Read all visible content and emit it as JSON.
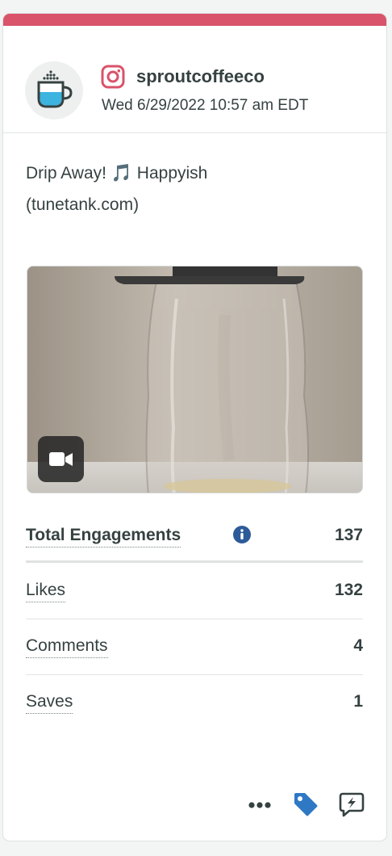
{
  "post": {
    "network_icon": "instagram-icon",
    "username": "sproutcoffeeco",
    "timestamp": "Wed 6/29/2022 10:57 am EDT",
    "caption_line1": "Drip Away! 🎵 Happyish",
    "caption_line2": "(tunetank.com)",
    "media_type": "video",
    "accent_color": "#d9536a"
  },
  "metrics": {
    "total_label": "Total Engagements",
    "total_value": "137",
    "rows": [
      {
        "label": "Likes",
        "value": "132"
      },
      {
        "label": "Comments",
        "value": "4"
      },
      {
        "label": "Saves",
        "value": "1"
      }
    ]
  },
  "footer": {
    "icons": [
      "more-options-icon",
      "tag-icon",
      "reply-compose-icon"
    ]
  }
}
